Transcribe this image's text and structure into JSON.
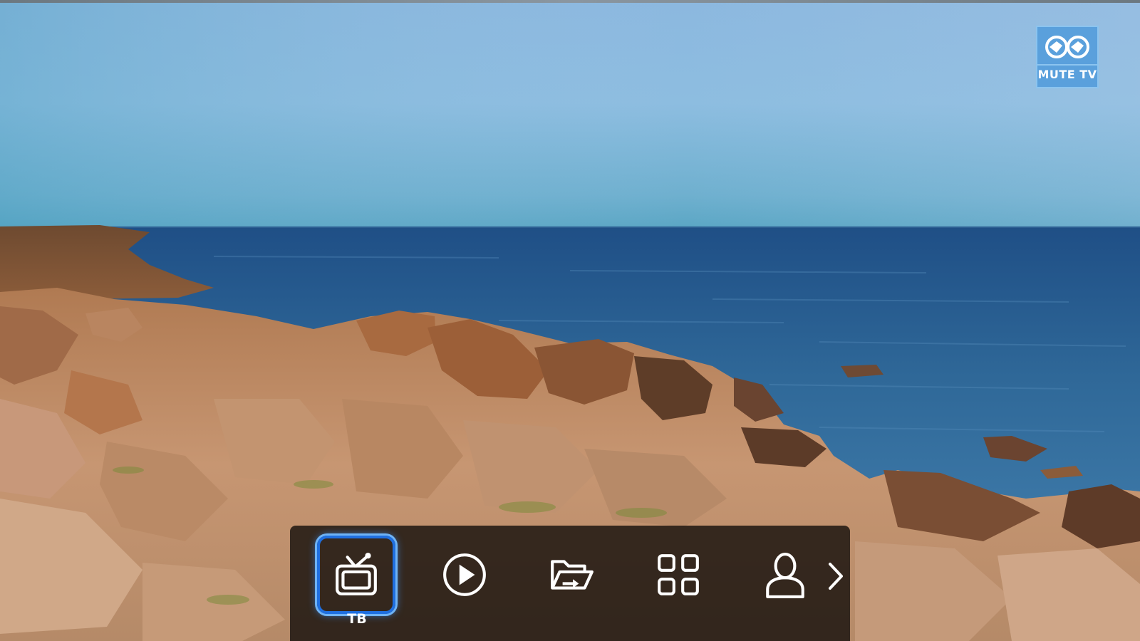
{
  "overlay": {
    "channel_logo_text": "MUTE TV"
  },
  "dock": {
    "items": [
      {
        "icon": "tv-icon",
        "label": "ТВ",
        "selected": true
      },
      {
        "icon": "play-icon",
        "label": "",
        "selected": false
      },
      {
        "icon": "folder-open-icon",
        "label": "",
        "selected": false
      },
      {
        "icon": "apps-grid-icon",
        "label": "",
        "selected": false
      },
      {
        "icon": "user-icon",
        "label": "",
        "selected": false
      }
    ],
    "next_icon": "chevron-right-icon"
  },
  "colors": {
    "selection_accent": "#1f6fe0",
    "logo_background": "#5aa0dc",
    "dock_background": "#0e0a08"
  }
}
